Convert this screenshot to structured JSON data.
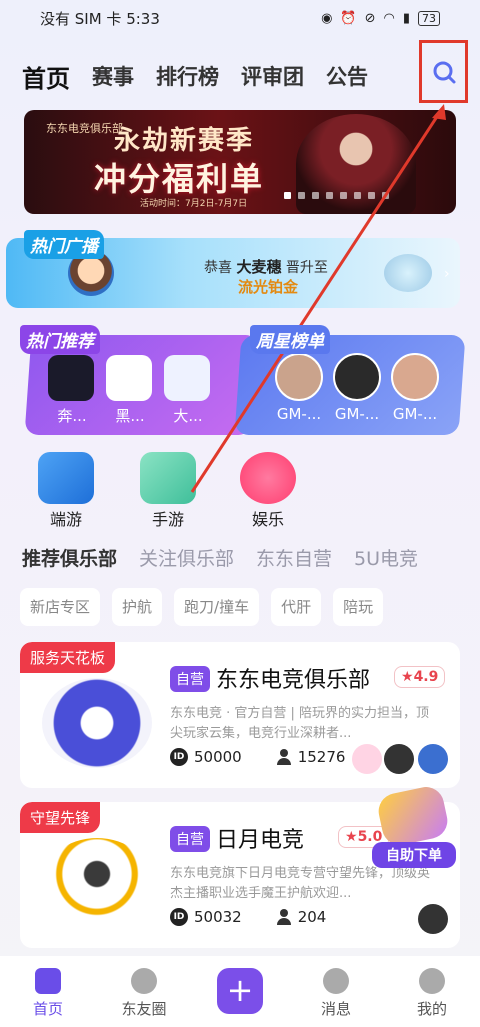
{
  "status": {
    "carrier": "没有 SIM 卡 5:33",
    "battery": "73"
  },
  "topnav": {
    "tabs": [
      "首页",
      "赛事",
      "排行榜",
      "评审团",
      "公告"
    ]
  },
  "banner": {
    "brand": "东东电竞俱乐部",
    "line1": "永劫新赛季",
    "line2": "冲分福利单",
    "date": "活动时间：7月2日-7月7日"
  },
  "broadcast": {
    "label": "热门广播",
    "prefix": "恭喜",
    "user": "大麦穗",
    "mid": "晋升至",
    "rank": "流光铂金"
  },
  "recommend": {
    "label": "热门推荐",
    "items": [
      "奔...",
      "黑...",
      "大..."
    ]
  },
  "weekly": {
    "label": "周星榜单",
    "items": [
      "GM-...",
      "GM-...",
      "GM-..."
    ]
  },
  "categories": [
    "端游",
    "手游",
    "娱乐"
  ],
  "club_tabs": [
    "推荐俱乐部",
    "关注俱乐部",
    "东东自营",
    "5U电竞"
  ],
  "chips": [
    "新店专区",
    "护航",
    "跑刀/撞车",
    "代肝",
    "陪玩"
  ],
  "cards": [
    {
      "tag": "服务天花板",
      "self": "自营",
      "name": "东东电竞俱乐部",
      "rating": "4.9",
      "desc": "东东电竞 · 官方自营 | 陪玩界的实力担当，顶尖玩家云集，电竞行业深耕者...",
      "id": "50000",
      "fans": "15276"
    },
    {
      "tag": "守望先锋",
      "self": "自营",
      "name": "日月电竞",
      "rating": "5.0",
      "desc": "东东电竞旗下日月电竞专营守望先锋，顶级英杰主播职业选手魔王护航欢迎...",
      "id": "50032",
      "fans": "204"
    }
  ],
  "float_button": "自助下单",
  "bottom_nav": [
    "首页",
    "东友圈",
    "+",
    "消息",
    "我的"
  ],
  "colors": {
    "accent": "#7b4fe9",
    "highlight_box": "#e0392b"
  }
}
